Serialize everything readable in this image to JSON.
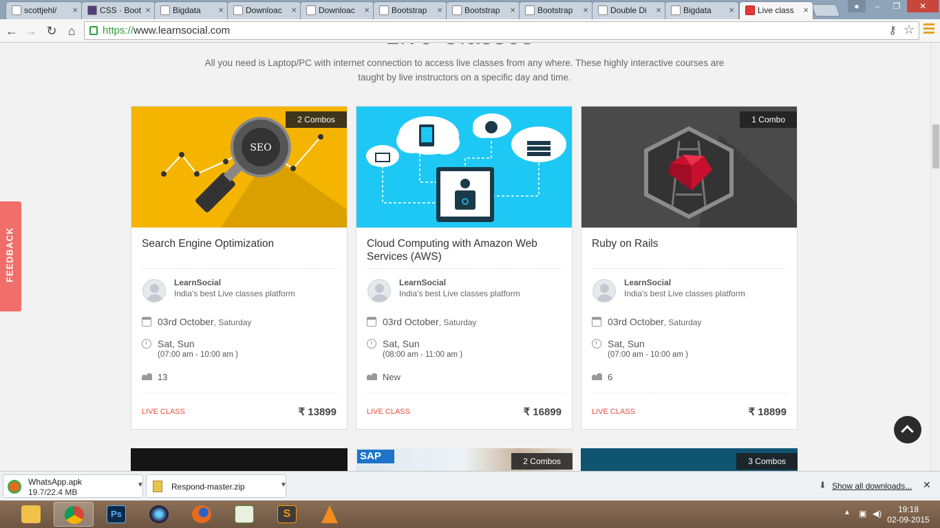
{
  "browser": {
    "tabs": [
      {
        "label": "scottjehl/",
        "active": false
      },
      {
        "label": "CSS · Boot",
        "active": false
      },
      {
        "label": "Bigdata",
        "active": false
      },
      {
        "label": "Downloac",
        "active": false
      },
      {
        "label": "Downloac",
        "active": false
      },
      {
        "label": "Bootstrap",
        "active": false
      },
      {
        "label": "Bootstrap",
        "active": false
      },
      {
        "label": "Bootstrap",
        "active": false
      },
      {
        "label": "Double Di",
        "active": false
      },
      {
        "label": "Bigdata",
        "active": false
      },
      {
        "label": "Live class",
        "active": true
      }
    ],
    "url_scheme": "https://",
    "url_host": "www.learnsocial.com"
  },
  "page": {
    "heading": "Live Classes",
    "intro": "All you need is Laptop/PC with internet connection to access live classes from any where. These highly interactive courses are taught by live instructors on a specific day and time.",
    "feedback_label": "FEEDBACK",
    "courses": [
      {
        "title": "Search Engine Optimization",
        "combo": "2 Combos",
        "instructor": "LearnSocial",
        "tagline": "India's best Live classes platform",
        "date": "03rd October",
        "weekday": ", Saturday",
        "days": "Sat, Sun",
        "time": "(07:00 am - 10:00 am )",
        "count": "13",
        "type": "LIVE CLASS",
        "price": "₹ 13899",
        "image_text": "SEO"
      },
      {
        "title": "Cloud Computing with Amazon Web Services (AWS)",
        "combo": "",
        "instructor": "LearnSocial",
        "tagline": "India's best Live classes platform",
        "date": "03rd October",
        "weekday": ", Saturday",
        "days": "Sat, Sun",
        "time": "(08:00 am - 11:00 am )",
        "count": "New",
        "type": "LIVE CLASS",
        "price": "₹ 16899"
      },
      {
        "title": "Ruby on Rails",
        "combo": "1 Combo",
        "instructor": "LearnSocial",
        "tagline": "India's best Live classes platform",
        "date": "03rd October",
        "weekday": ", Saturday",
        "days": "Sat, Sun",
        "time": "(07:00 am - 10:00 am )",
        "count": "6",
        "type": "LIVE CLASS",
        "price": "₹ 18899"
      }
    ],
    "next_row": [
      {
        "combo": ""
      },
      {
        "combo": "2 Combos",
        "image_text": "SAP"
      },
      {
        "combo": "3 Combos"
      }
    ]
  },
  "downloads": {
    "items": [
      {
        "name": "WhatsApp.apk",
        "size": "19.7/22.4 MB"
      },
      {
        "name": "Respond-master.zip",
        "size": ""
      }
    ],
    "show_all": "Show all downloads..."
  },
  "taskbar": {
    "time": "19:18",
    "date": "02-09-2015"
  },
  "colors": {
    "seo_bg": "#f5b400",
    "aws_bg": "#1ec8f5",
    "ruby_bg": "#4a4a4a",
    "live_red": "#e74c3c",
    "feedback": "#f06d6a"
  }
}
